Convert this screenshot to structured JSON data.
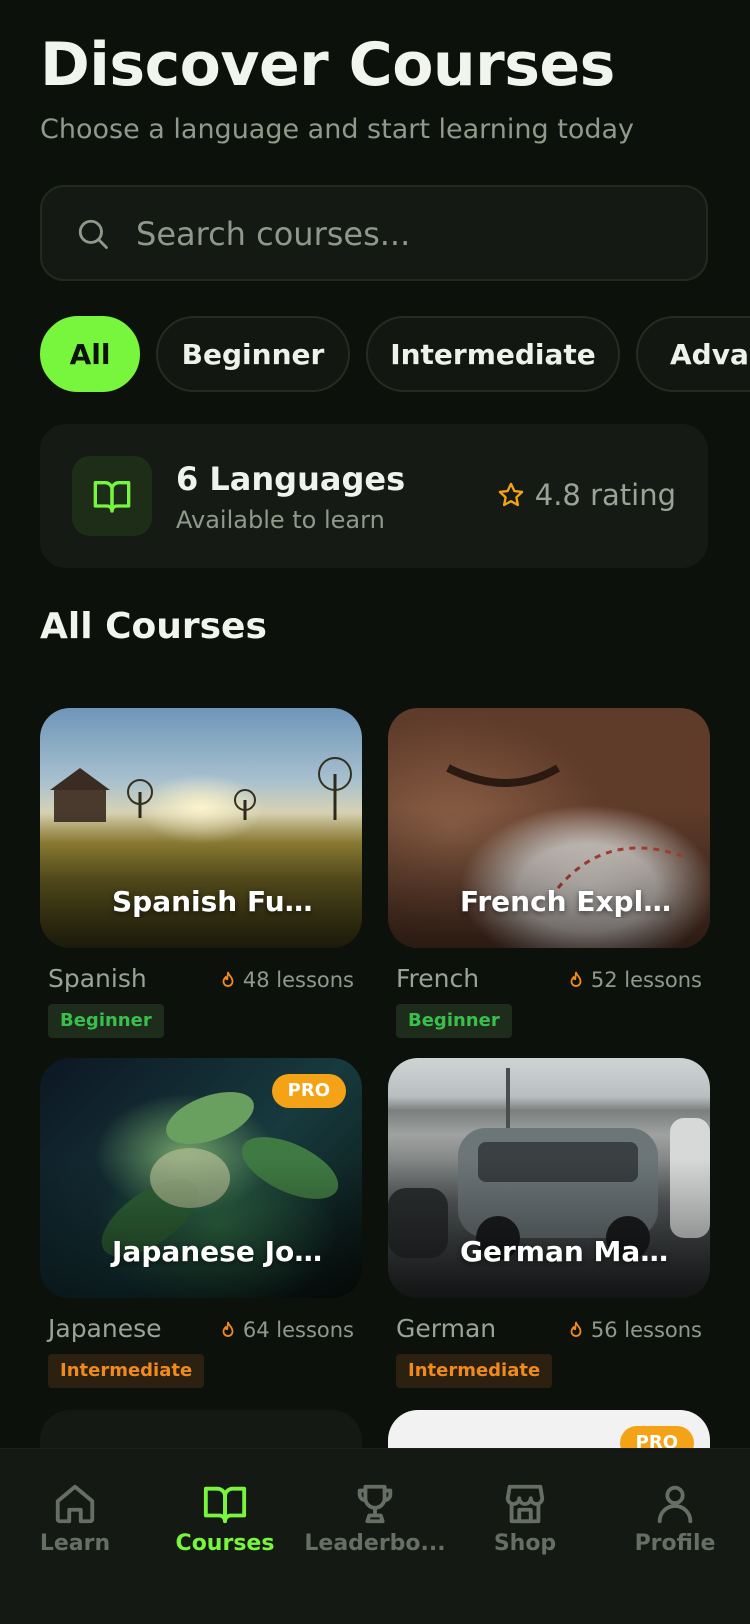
{
  "header": {
    "title": "Discover Courses",
    "subtitle": "Choose a language and start learning today"
  },
  "search": {
    "placeholder": "Search courses...",
    "icon": "search-icon"
  },
  "filters": [
    {
      "label": "All",
      "active": true
    },
    {
      "label": "Beginner",
      "active": false
    },
    {
      "label": "Intermediate",
      "active": false
    },
    {
      "label": "Advan",
      "active": false
    }
  ],
  "stats": {
    "count_label": "6 Languages",
    "sub_label": "Available to learn",
    "rating_label": "4.8 rating",
    "icon": "book-open-icon",
    "rating_icon": "star-icon"
  },
  "section_title": "All Courses",
  "courses": [
    {
      "title": "Spanish Fund...",
      "language": "Spanish",
      "lessons": "48 lessons",
      "level": "Beginner",
      "pro": false
    },
    {
      "title": "French Explorer",
      "language": "French",
      "lessons": "52 lessons",
      "level": "Beginner",
      "pro": false
    },
    {
      "title": "Japanese Jour...",
      "language": "Japanese",
      "lessons": "64 lessons",
      "level": "Intermediate",
      "pro": true,
      "pro_label": "PRO"
    },
    {
      "title": "German Mast...",
      "language": "German",
      "lessons": "56 lessons",
      "level": "Intermediate",
      "pro": false
    },
    {
      "pro": false
    },
    {
      "pro": true,
      "pro_label": "PRO"
    }
  ],
  "tabs": [
    {
      "label": "Learn",
      "icon": "home-icon",
      "active": false
    },
    {
      "label": "Courses",
      "icon": "book-open-icon",
      "active": true
    },
    {
      "label": "Leaderbo...",
      "icon": "trophy-icon",
      "active": false
    },
    {
      "label": "Shop",
      "icon": "store-icon",
      "active": false
    },
    {
      "label": "Profile",
      "icon": "user-icon",
      "active": false
    }
  ],
  "colors": {
    "background": "#0d110c",
    "accent": "#78f53d",
    "pro": "#f5a316",
    "beginner": "#3bbf4c",
    "intermediate": "#f08a1c"
  }
}
